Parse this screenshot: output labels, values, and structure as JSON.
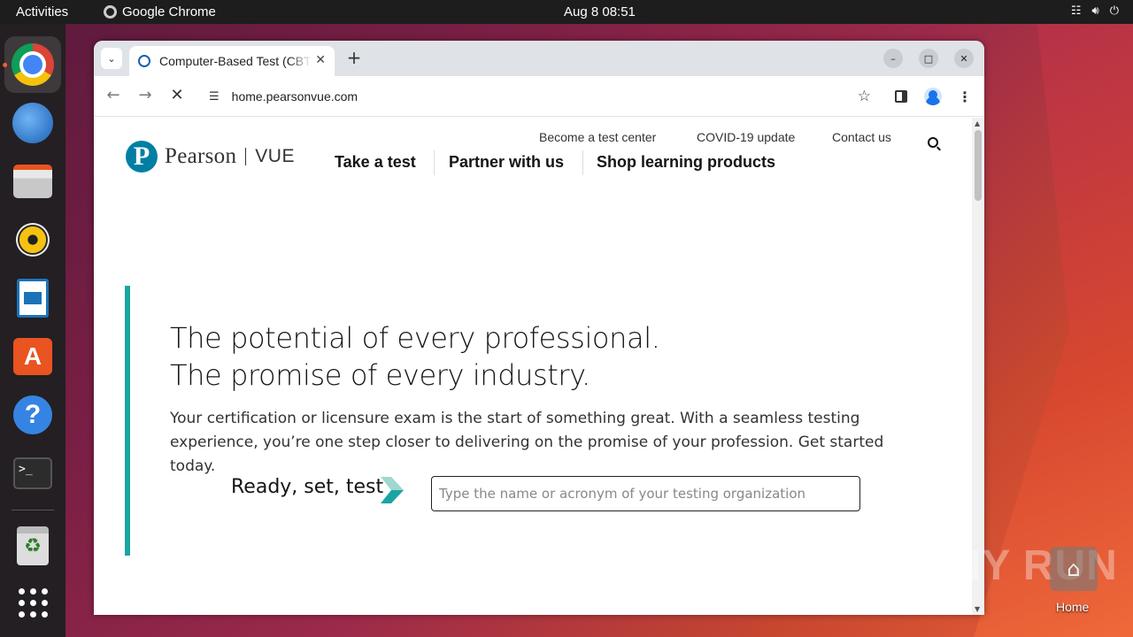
{
  "topbar": {
    "activities": "Activities",
    "app_name": "Google Chrome",
    "clock": "Aug 8  08:51"
  },
  "dock": {
    "items": [
      "Google Chrome",
      "Thunderbird Mail",
      "Files",
      "Rhythmbox",
      "LibreOffice Writer",
      "Ubuntu Software",
      "Help",
      "Terminal",
      "Trash",
      "Show Applications"
    ]
  },
  "browser": {
    "tab_title": "Computer-Based Test (CBT)",
    "url": "home.pearsonvue.com"
  },
  "site": {
    "logo_pearson": "Pearson",
    "logo_vue": "VUE",
    "utility_nav": [
      "Become a test center",
      "COVID-19 update",
      "Contact us"
    ],
    "main_nav": [
      "Take a test",
      "Partner with us",
      "Shop learning products"
    ],
    "hero_line1": "The potential of every professional.",
    "hero_line2": "The promise of every industry.",
    "hero_body": "Your certification or licensure exam is the start of something great. With a seamless testing experience, you’re one step closer to delivering on the promise of your profession. Get started today.",
    "ready_label": "Ready, set, test",
    "search_placeholder": "Type the name or acronym of your testing organization",
    "accent_color": "#19a5a1"
  },
  "desktop": {
    "home_label": "Home",
    "watermark": "ANY RUN"
  }
}
